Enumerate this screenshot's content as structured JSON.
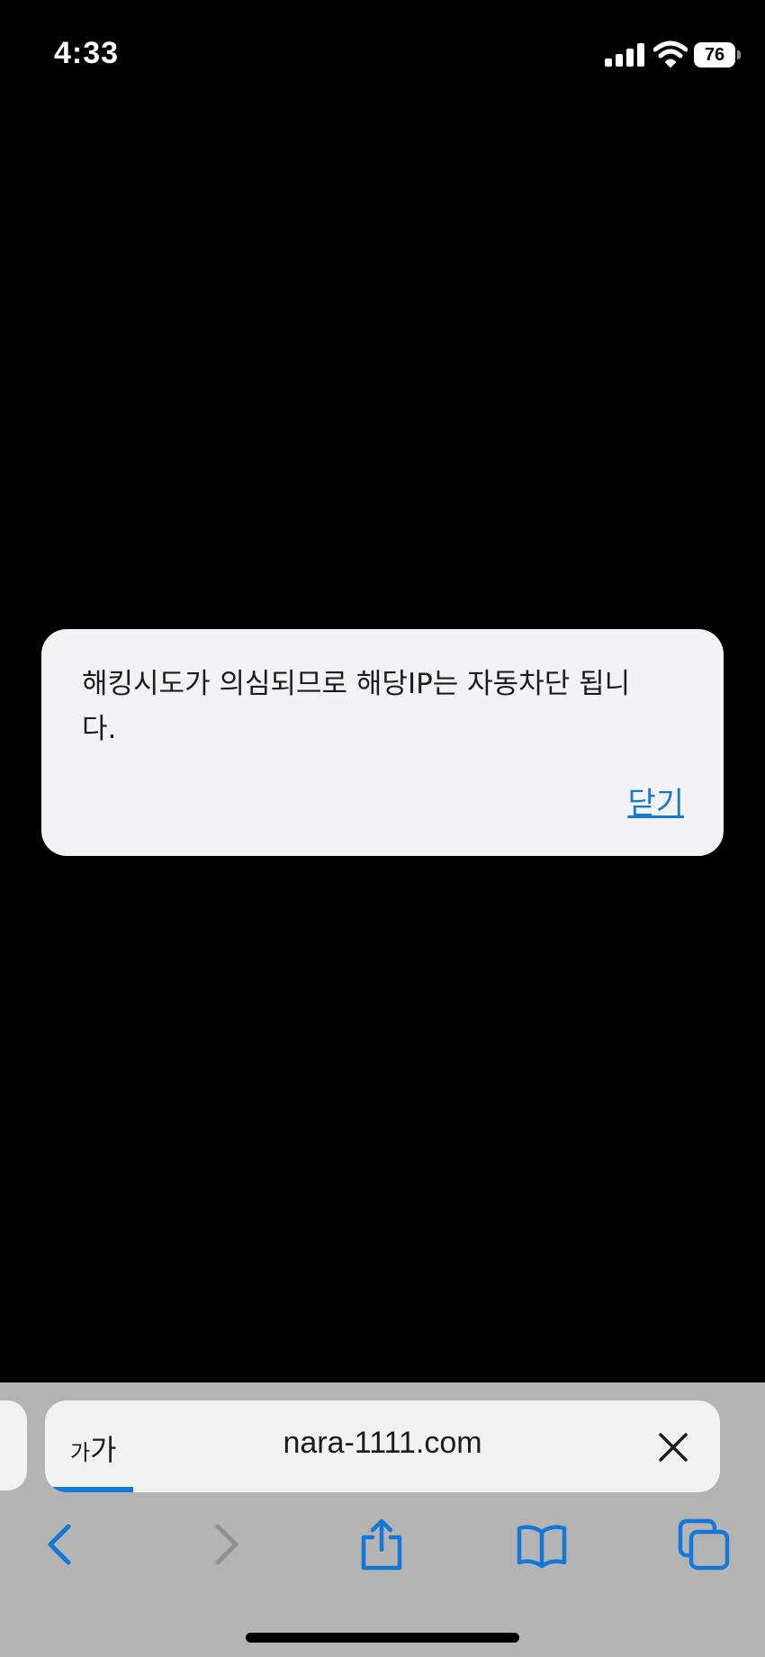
{
  "status_bar": {
    "time": "4:33",
    "battery_percent": "76",
    "icons": [
      "cellular-signal-icon",
      "wifi-icon",
      "battery-icon"
    ]
  },
  "alert": {
    "message": "해킹시도가 의심되므로 해당IP는 자동차단 됩니다.",
    "close_label": "닫기"
  },
  "address_bar": {
    "reader_label_small": "가",
    "reader_label_large": "가",
    "url": "nara-1111.com",
    "load_progress": 0.13
  },
  "toolbar": {
    "icons": [
      "back-icon",
      "forward-icon",
      "share-icon",
      "bookmarks-icon",
      "tabs-icon"
    ]
  },
  "colors": {
    "accent": "#1479d6",
    "background": "#000000",
    "alert_background": "#f2f2f7",
    "chrome_background": "#b4b4b4"
  }
}
